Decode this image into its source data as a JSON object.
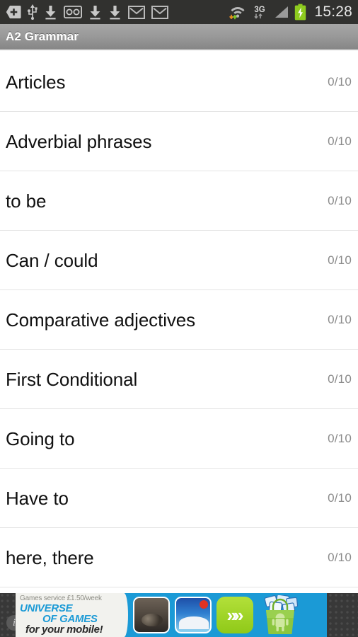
{
  "status_bar": {
    "background_color": "#31312f",
    "clock": "15:28",
    "network_type": "3G",
    "left_icons": [
      {
        "name": "sim-card-add-icon",
        "label": "SIM add"
      },
      {
        "name": "usb-icon",
        "label": "USB connected"
      },
      {
        "name": "download-icon",
        "label": "Download"
      },
      {
        "name": "voicemail-icon",
        "label": "Voicemail"
      },
      {
        "name": "download-icon",
        "label": "Download"
      },
      {
        "name": "download-icon",
        "label": "Download"
      },
      {
        "name": "gmail-icon",
        "label": "Gmail"
      },
      {
        "name": "gmail-icon",
        "label": "Gmail"
      }
    ],
    "right_icons": [
      {
        "name": "wifi-icon",
        "label": "Wi-Fi signal"
      },
      {
        "name": "mobile-data-3g-icon",
        "label": "3G"
      },
      {
        "name": "cellular-signal-icon",
        "label": "Cellular signal"
      },
      {
        "name": "battery-charging-icon",
        "label": "Battery charging"
      }
    ]
  },
  "title_bar": {
    "title": "A2 Grammar",
    "background_from": "#a6a6a6",
    "background_to": "#868686",
    "text_color": "#ffffff"
  },
  "list": {
    "score_color": "#8a8a8a",
    "label_color": "#111111",
    "divider_color": "#e4e4e4",
    "items": [
      {
        "label": "Articles",
        "score": "0/10"
      },
      {
        "label": "Adverbial phrases",
        "score": "0/10"
      },
      {
        "label": "to be",
        "score": "0/10"
      },
      {
        "label": "Can / could",
        "score": "0/10"
      },
      {
        "label": "Comparative adjectives",
        "score": "0/10"
      },
      {
        "label": "First Conditional",
        "score": "0/10"
      },
      {
        "label": "Going to",
        "score": "0/10"
      },
      {
        "label": "Have to",
        "score": "0/10"
      },
      {
        "label": "here, there",
        "score": "0/10"
      }
    ]
  },
  "ad_banner": {
    "background_color": "#383838",
    "content_background": "#1b9ad6",
    "info_badge": "i",
    "tagline": "Games service £1.50/week",
    "brand_line_1": "UNIVERSE",
    "brand_line_2": "OF GAMES",
    "subtitle": "for your mobile!",
    "brand_color": "#1b9ad6",
    "cta_icon": "double-chevron-right-icon",
    "cta_color": "#8fc918",
    "thumbnails": [
      {
        "name": "ad-thumbnail-motocross"
      },
      {
        "name": "ad-thumbnail-bubble-shoot"
      }
    ],
    "store_icon": "android-play-bag-icon"
  }
}
